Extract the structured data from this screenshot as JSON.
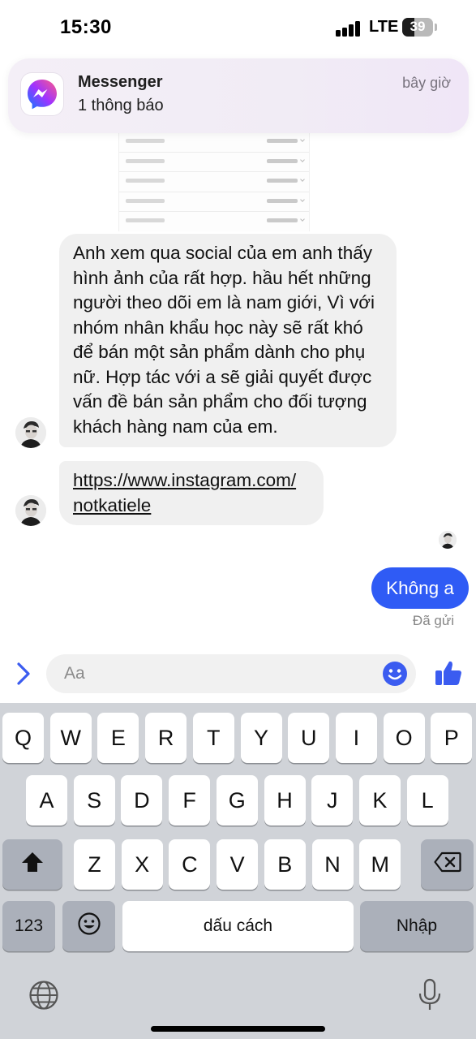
{
  "status_bar": {
    "time": "15:30",
    "network": "LTE",
    "battery_percent": "39",
    "battery_level": 0.39,
    "signal_bars": 4
  },
  "notification": {
    "app": "Messenger",
    "body": "1 thông báo",
    "time": "bây giờ",
    "icon": "messenger-logo"
  },
  "messages": {
    "received_1": "Anh xem qua social của em anh thấy hình ảnh của rất hợp. hầu hết những người theo dõi em là nam giới, Vì với nhóm nhân khẩu học này sẽ rất khó để bán một sản phẩm dành cho phụ nữ. Hợp tác với a sẽ giải quyết được vấn đề bán sản phẩm cho đối tượng khách hàng nam của em.",
    "received_2_lines": [
      "https://www.instagram.com/",
      "notkatiele"
    ],
    "sent_1": "Không a",
    "sent_status": "Đã gửi"
  },
  "composer": {
    "placeholder": "Aa",
    "expand_icon": "chevron-right-icon",
    "emoji_icon": "smiley-icon",
    "like_icon": "thumbs-up-icon"
  },
  "keyboard": {
    "row1": [
      "Q",
      "W",
      "E",
      "R",
      "T",
      "Y",
      "U",
      "I",
      "O",
      "P"
    ],
    "row2": [
      "A",
      "S",
      "D",
      "F",
      "G",
      "H",
      "J",
      "K",
      "L"
    ],
    "row3": [
      "Z",
      "X",
      "C",
      "V",
      "B",
      "N",
      "M"
    ],
    "numbers_key": "123",
    "space_key": "dấu cách",
    "return_key": "Nhập",
    "shift_icon": "shift-icon",
    "backspace_icon": "backspace-icon",
    "emoji_icon": "emoji-keyboard-icon",
    "globe_icon": "globe-icon",
    "mic_icon": "microphone-icon"
  },
  "colors": {
    "sent_bubble": "#2f5bf5",
    "received_bubble": "#f0f0f0",
    "accent": "#3b5cf0",
    "keyboard_bg": "#d0d3d8"
  }
}
